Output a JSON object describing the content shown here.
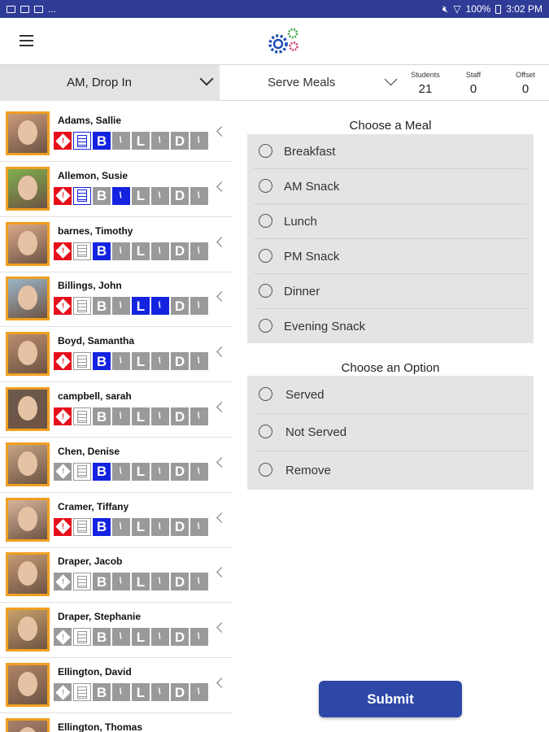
{
  "status_bar": {
    "left_dots": "...",
    "battery": "100%",
    "time": "3:02 PM"
  },
  "app": {
    "logo_icon": "gears-icon",
    "menu_icon": "hamburger-menu-icon"
  },
  "toolbar": {
    "session": "AM, Drop In",
    "action": "Serve Meals",
    "students_label": "Students",
    "students_value": "21",
    "staff_label": "Staff",
    "staff_value": "0",
    "offset_label": "Offset",
    "offset_value": "0"
  },
  "students": [
    {
      "name": "Adams, Sallie",
      "badges": [
        "red-dia",
        "doc-on",
        "B-blue",
        "sl",
        "L",
        "sl",
        "D",
        "sl"
      ]
    },
    {
      "name": "Allemon, Susie",
      "badges": [
        "red-dia",
        "doc-on",
        "B",
        "sl-blue",
        "L",
        "sl",
        "D",
        "sl"
      ]
    },
    {
      "name": "barnes, Timothy",
      "badges": [
        "red-dia",
        "doc",
        "B-blue",
        "sl",
        "L",
        "sl",
        "D",
        "sl"
      ]
    },
    {
      "name": "Billings, John",
      "badges": [
        "red-dia",
        "doc",
        "B",
        "sl",
        "L-blue",
        "sl-blue",
        "D",
        "sl"
      ]
    },
    {
      "name": "Boyd, Samantha",
      "badges": [
        "red-dia",
        "doc",
        "B-blue",
        "sl",
        "L",
        "sl",
        "D",
        "sl"
      ]
    },
    {
      "name": "campbell, sarah",
      "badges": [
        "red-dia",
        "doc",
        "B",
        "sl",
        "L",
        "sl",
        "D",
        "sl"
      ]
    },
    {
      "name": "Chen, Denise",
      "badges": [
        "gray-dia",
        "doc",
        "B-blue",
        "sl",
        "L",
        "sl",
        "D",
        "sl"
      ]
    },
    {
      "name": "Cramer, Tiffany",
      "badges": [
        "red-dia",
        "doc",
        "B-blue",
        "sl",
        "L",
        "sl",
        "D",
        "sl"
      ]
    },
    {
      "name": "Draper, Jacob",
      "badges": [
        "gray-dia",
        "doc",
        "B",
        "sl",
        "L",
        "sl",
        "D",
        "sl"
      ]
    },
    {
      "name": "Draper, Stephanie",
      "badges": [
        "gray-dia",
        "doc",
        "B",
        "sl",
        "L",
        "sl",
        "D",
        "sl"
      ]
    },
    {
      "name": "Ellington, David",
      "badges": [
        "gray-dia",
        "doc",
        "B",
        "sl",
        "L",
        "sl",
        "D",
        "sl"
      ]
    },
    {
      "name": "Ellington, Thomas",
      "badges": []
    }
  ],
  "meal_panel": {
    "title": "Choose a Meal",
    "options": [
      "Breakfast",
      "AM Snack",
      "Lunch",
      "PM Snack",
      "Dinner",
      "Evening Snack"
    ]
  },
  "option_panel": {
    "title": "Choose an Option",
    "options": [
      "Served",
      "Not Served",
      "Remove"
    ]
  },
  "submit_label": "Submit",
  "colors": {
    "status_bar": "#2e3b97",
    "badge_blue": "#1423e0",
    "badge_red": "#e5101b",
    "badge_gray": "#9a9a9a",
    "submit": "#2e48a8",
    "avatar_border": "#f0a020"
  }
}
